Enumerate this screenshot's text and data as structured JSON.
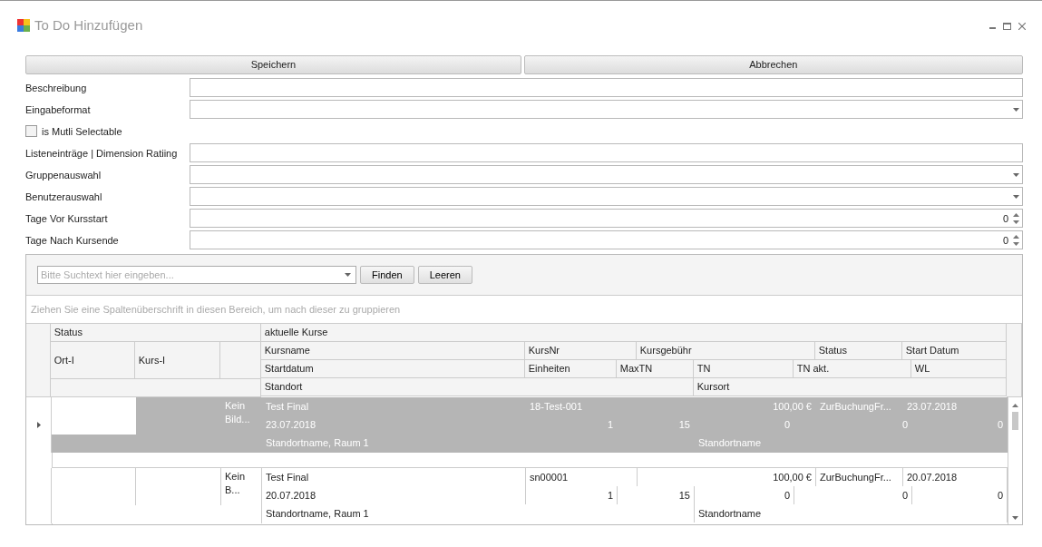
{
  "window": {
    "title": "To Do Hinzufügen"
  },
  "buttons": [
    {
      "label": "Speichern"
    },
    {
      "label": "Abbrechen"
    }
  ],
  "fields": [
    {
      "kind": "text",
      "label": "Beschreibung"
    },
    {
      "kind": "dropdown",
      "label": "Eingabeformat"
    },
    {
      "kind": "checkbox",
      "label": "is Mutli Selectable",
      "checked": false
    },
    {
      "kind": "text",
      "label": "Listeneinträge | Dimension Ratiing"
    },
    {
      "kind": "dropdown",
      "label": "Gruppenauswahl"
    },
    {
      "kind": "dropdown",
      "label": "Benutzerauswahl"
    },
    {
      "kind": "spin",
      "label": "Tage Vor Kursstart",
      "value": "0"
    },
    {
      "kind": "spin",
      "label": "Tage Nach Kursende",
      "value": "0"
    }
  ],
  "grid": {
    "search": {
      "placeholder": "Bitte Suchtext hier eingeben..."
    },
    "search_buttons": [
      {
        "label": "Finden"
      },
      {
        "label": "Leeren"
      }
    ],
    "group_panel_hint": "Ziehen Sie eine Spaltenüberschrift in diesen Bereich, um nach dieser zu gruppieren",
    "bands": [
      "Status",
      "aktuelle Kurse"
    ],
    "left_columns": [
      "Ort-I",
      "Kurs-I"
    ],
    "course_columns": [
      [
        "Kursname",
        "KursNr",
        "Kursgebühr",
        "Status",
        "Start Datum"
      ],
      [
        "Startdatum",
        "Einheiten",
        "MaxTN",
        "TN",
        "TN akt.",
        "WL"
      ],
      [
        "Standort",
        "Kursort"
      ]
    ],
    "rows": [
      {
        "selected": true,
        "picture": "Kein Bild...",
        "lines": [
          [
            "Test Final",
            "18-Test-001",
            "100,00 €",
            "ZurBuchungFr...",
            "23.07.2018"
          ],
          [
            "23.07.2018",
            "1",
            "15",
            "0",
            "0",
            "0"
          ],
          [
            "Standortname, Raum 1",
            "Standortname"
          ]
        ]
      },
      {
        "selected": false,
        "picture": "Kein B...",
        "lines": [
          [
            "Test Final",
            "sn00001",
            "100,00 €",
            "ZurBuchungFr...",
            "20.07.2018"
          ],
          [
            "20.07.2018",
            "1",
            "15",
            "0",
            "0",
            "0"
          ],
          [
            "Standortname, Raum 1",
            "Standortname"
          ]
        ]
      }
    ]
  }
}
